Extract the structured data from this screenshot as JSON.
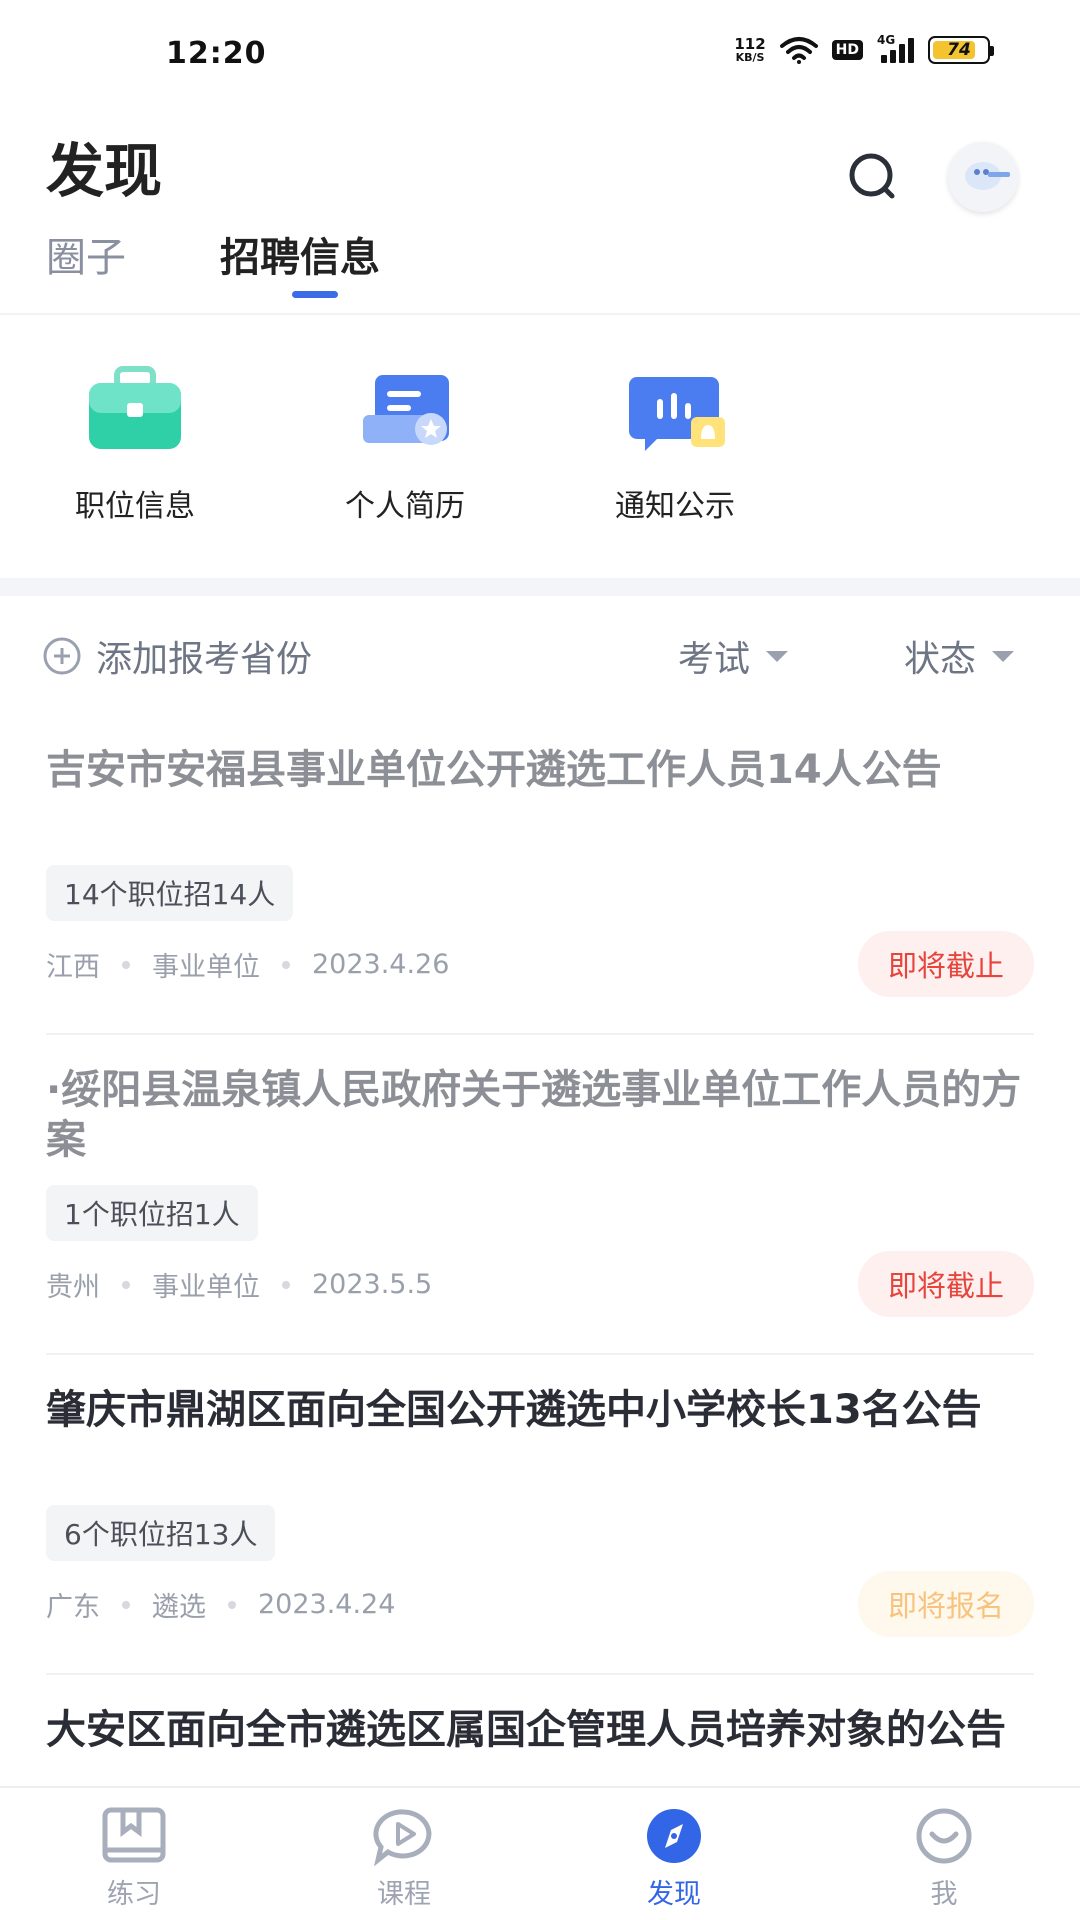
{
  "status_bar": {
    "time": "12:20",
    "net_speed_value": "112",
    "net_speed_unit": "KB/S",
    "hd": "HD",
    "network": "4G",
    "battery": "74"
  },
  "header": {
    "title": "发现",
    "search_icon": "search-icon",
    "avatar_icon": "avatar-icon"
  },
  "tabs": [
    {
      "label": "圈子",
      "active": false
    },
    {
      "label": "招聘信息",
      "active": true
    }
  ],
  "shortcuts": [
    {
      "label": "职位信息",
      "icon": "briefcase-icon"
    },
    {
      "label": "个人简历",
      "icon": "resume-icon"
    },
    {
      "label": "通知公示",
      "icon": "notice-icon"
    }
  ],
  "filters": {
    "add_province": "添加报考省份",
    "exam": "考试",
    "status": "状态"
  },
  "jobs": [
    {
      "title": "吉安市安福县事业单位公开遴选工作人员14人公告",
      "tag": "14个职位招14人",
      "province": "江西",
      "category": "事业单位",
      "date": "2023.4.26",
      "badge": "即将截止",
      "read": true
    },
    {
      "title": "·绥阳县温泉镇人民政府关于遴选事业单位工作人员的方案",
      "tag": "1个职位招1人",
      "province": "贵州",
      "category": "事业单位",
      "date": "2023.5.5",
      "badge": "即将截止",
      "read": true
    },
    {
      "title": "肇庆市鼎湖区面向全国公开遴选中小学校长13名公告",
      "tag": "6个职位招13人",
      "province": "广东",
      "category": "遴选",
      "date": "2023.4.24",
      "badge": "即将报名",
      "read": false
    },
    {
      "title": "大安区面向全市遴选区属国企管理人员培养对象的公告",
      "read": false
    }
  ],
  "bottom_nav": [
    {
      "label": "练习",
      "icon": "practice-icon",
      "active": false
    },
    {
      "label": "课程",
      "icon": "course-icon",
      "active": false
    },
    {
      "label": "发现",
      "icon": "compass-icon",
      "active": true
    },
    {
      "label": "我",
      "icon": "profile-icon",
      "active": false
    }
  ],
  "colors": {
    "accent": "#3d6be8",
    "deadline": "#e5453c",
    "upcoming": "#f7c37e"
  }
}
